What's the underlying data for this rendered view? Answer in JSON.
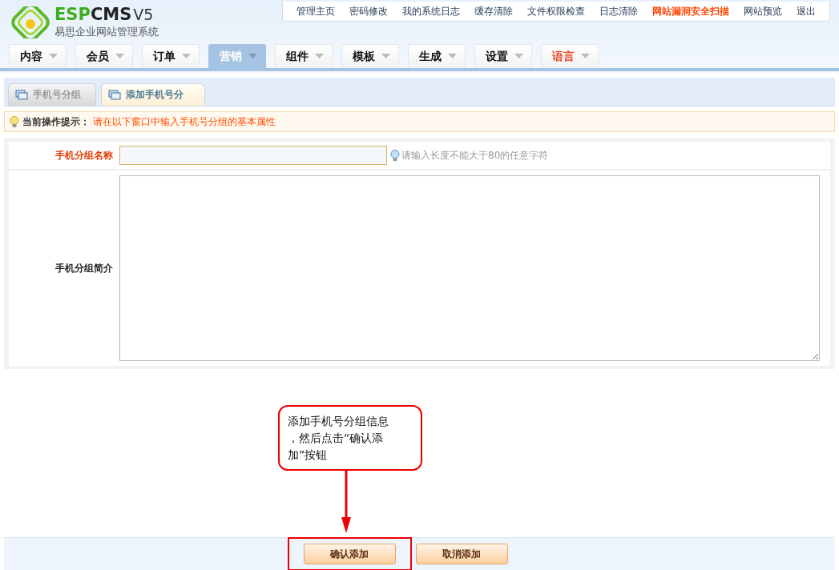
{
  "logo": {
    "brand_a": "ESP",
    "brand_b": "CMS",
    "version": "V5",
    "subtitle": "易思企业网站管理系统"
  },
  "top_links": [
    {
      "label": "管理主页",
      "highlight": false
    },
    {
      "label": "密码修改",
      "highlight": false
    },
    {
      "label": "我的系统日志",
      "highlight": false
    },
    {
      "label": "缓存清除",
      "highlight": false
    },
    {
      "label": "文件权限检查",
      "highlight": false
    },
    {
      "label": "日志清除",
      "highlight": false
    },
    {
      "label": "网站漏洞安全扫描",
      "highlight": true
    },
    {
      "label": "网站预览",
      "highlight": false
    },
    {
      "label": "退出",
      "highlight": false
    }
  ],
  "nav_tabs": [
    {
      "label": "内容",
      "selected": false,
      "highlight": false
    },
    {
      "label": "会员",
      "selected": false,
      "highlight": false
    },
    {
      "label": "订单",
      "selected": false,
      "highlight": false
    },
    {
      "label": "营销",
      "selected": true,
      "highlight": false
    },
    {
      "label": "组件",
      "selected": false,
      "highlight": false
    },
    {
      "label": "模板",
      "selected": false,
      "highlight": false
    },
    {
      "label": "生成",
      "selected": false,
      "highlight": false
    },
    {
      "label": "设置",
      "selected": false,
      "highlight": false
    },
    {
      "label": "语言",
      "selected": false,
      "highlight": true
    }
  ],
  "sub_tabs": [
    {
      "label": "手机号分组",
      "selected": false
    },
    {
      "label": "添加手机号分",
      "selected": true
    }
  ],
  "tip": {
    "label": "当前操作提示：",
    "text": "请在以下窗口中输入手机号分组的基本属性"
  },
  "form": {
    "name_label": "手机分组名称",
    "name_hint": "请输入长度不能大于80的任意字符",
    "desc_label": "手机分组简介"
  },
  "callout": {
    "lines": [
      "添加手机号分组信息",
      "，然后点击“确认添",
      "加”按钮"
    ]
  },
  "buttons": [
    {
      "label": "确认添加",
      "highlighted": true
    },
    {
      "label": "取消添加",
      "highlighted": false
    }
  ]
}
